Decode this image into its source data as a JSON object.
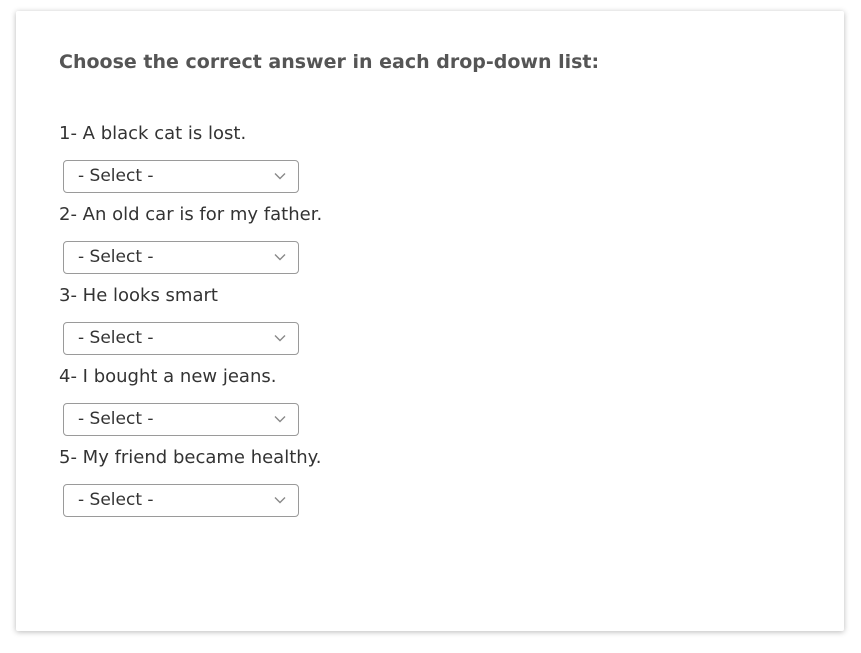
{
  "instructions": "Choose the correct answer in each drop-down list:",
  "questions": [
    {
      "text": "1- A black cat is lost.",
      "selected": "- Select -"
    },
    {
      "text": "2- An old car is for my father.",
      "selected": "- Select -"
    },
    {
      "text": "3- He looks smart",
      "selected": "- Select -"
    },
    {
      "text": "4- I bought a new jeans.",
      "selected": "- Select -"
    },
    {
      "text": "5- My friend became healthy.",
      "selected": "- Select -"
    }
  ],
  "icons": {
    "dropdown": "chevron-down-icon"
  },
  "colors": {
    "text": "#333333",
    "heading": "#555555",
    "border": "#9a9a9a"
  }
}
